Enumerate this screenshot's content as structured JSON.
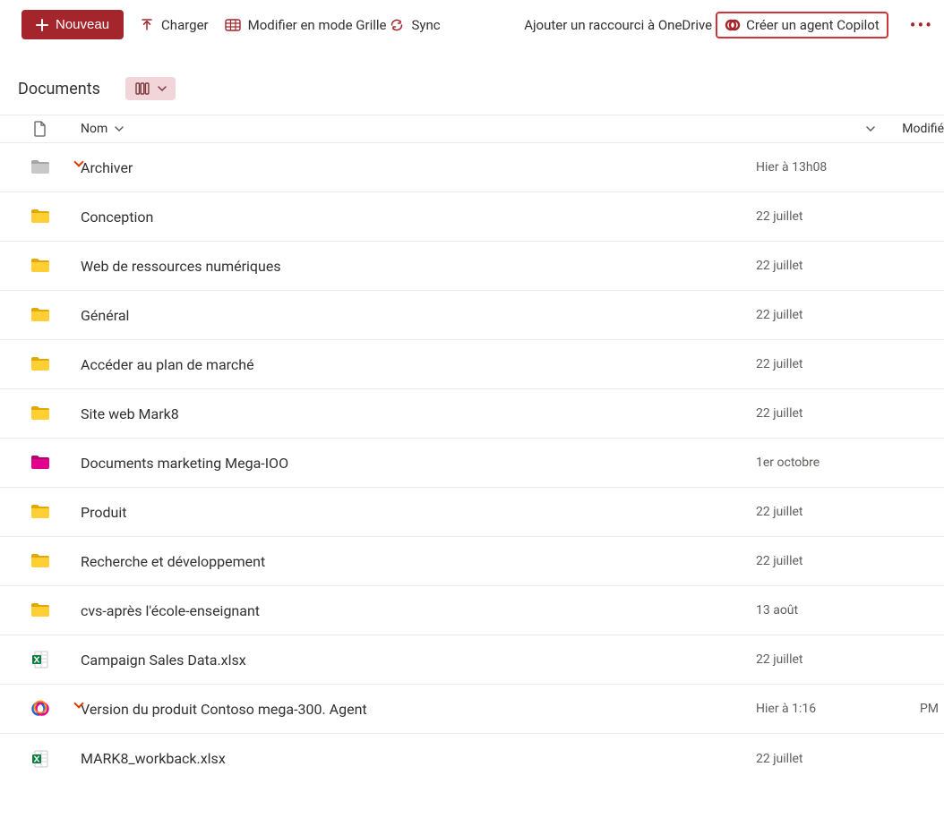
{
  "toolbar": {
    "new_label": "Nouveau",
    "upload_label": "Charger",
    "grid_label": "Modifier en mode Grille",
    "sync_label": "Sync",
    "shortcut_label": "Ajouter un raccourci à OneDrive",
    "copilot_label": "Créer un agent Copilot"
  },
  "header": {
    "title": "Documents"
  },
  "columns": {
    "name": "Nom",
    "modified": "Modifié"
  },
  "row_extra": "PM",
  "items": [
    {
      "icon": "folder-grey",
      "name": "Archiver",
      "modified": "Hier à 13h08",
      "link": true
    },
    {
      "icon": "folder-yellow",
      "name": "Conception",
      "modified": "22 juillet"
    },
    {
      "icon": "folder-yellow",
      "name": "Web de ressources numériques",
      "modified": "22 juillet"
    },
    {
      "icon": "folder-yellow",
      "name": "Général",
      "modified": "22 juillet"
    },
    {
      "icon": "folder-yellow",
      "name": "Accéder au plan de marché",
      "modified": "22 juillet"
    },
    {
      "icon": "folder-yellow",
      "name": "Site web Mark8",
      "modified": "22 juillet"
    },
    {
      "icon": "folder-pink",
      "name": "Documents marketing Mega-IOO",
      "modified": "1er octobre"
    },
    {
      "icon": "folder-yellow",
      "name": "Produit",
      "modified": "22 juillet"
    },
    {
      "icon": "folder-yellow",
      "name": "Recherche et développement",
      "modified": "22 juillet"
    },
    {
      "icon": "folder-yellow",
      "name": "cvs-après l'école-enseignant",
      "modified": "13 août"
    },
    {
      "icon": "excel",
      "name": "Campaign Sales Data.xlsx",
      "modified": "22 juillet"
    },
    {
      "icon": "copilot",
      "name": "Version du produit Contoso mega-300. Agent",
      "modified": "Hier à 1:16",
      "extra": "PM",
      "link": true
    },
    {
      "icon": "excel",
      "name": "MARK8_workback.xlsx",
      "modified": "22 juillet"
    }
  ]
}
